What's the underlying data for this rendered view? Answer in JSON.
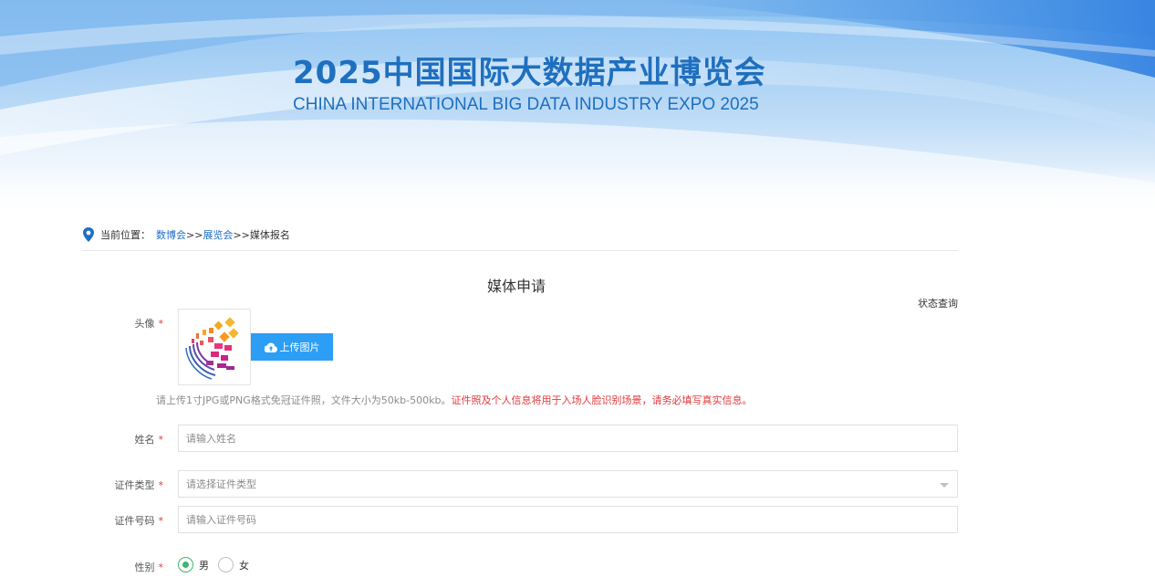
{
  "banner": {
    "title_cn": "2025中国国际大数据产业博览会",
    "title_en": "CHINA INTERNATIONAL BIG DATA INDUSTRY EXPO 2025"
  },
  "breadcrumb": {
    "label": "当前位置：",
    "items": [
      "数博会",
      "展览会"
    ],
    "separator": ">>",
    "current": "媒体报名"
  },
  "form": {
    "title": "媒体申请",
    "status_link": "状态查询",
    "required_mark": "*",
    "avatar": {
      "label": "头像",
      "upload_label": "上传图片",
      "hint_gray": "请上传1寸JPG或PNG格式免冠证件照，文件大小为50kb-500kb。",
      "hint_red": "证件照及个人信息将用于入场人脸识别场景，请务必填写真实信息。"
    },
    "name": {
      "label": "姓名",
      "placeholder": "请输入姓名",
      "value": ""
    },
    "id_type": {
      "label": "证件类型",
      "placeholder": "请选择证件类型"
    },
    "id_number": {
      "label": "证件号码",
      "placeholder": "请输入证件号码",
      "value": ""
    },
    "gender": {
      "label": "性别",
      "options": [
        "男",
        "女"
      ],
      "selected": "男"
    }
  },
  "colors": {
    "accent": "#2c9ef6",
    "title_blue": "#1f6fbf",
    "link": "#1d6fc6",
    "required_red": "#e3393c",
    "radio_green": "#3db56d"
  },
  "icons": {
    "breadcrumb": "location-pin-icon",
    "upload": "cloud-upload-icon",
    "select": "caret-down-icon"
  }
}
